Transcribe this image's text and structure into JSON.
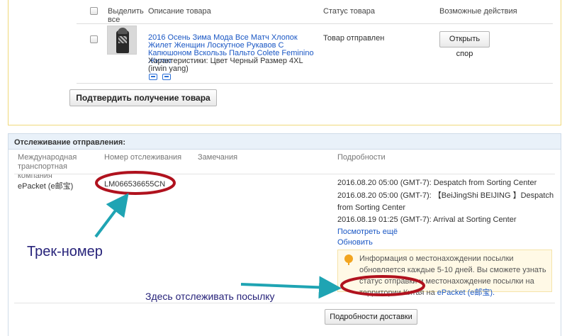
{
  "order": {
    "columns": {
      "select_all": "Выделить все",
      "description": "Описание товара",
      "status": "Статус товара",
      "actions": "Возможные действия"
    },
    "item": {
      "title": "2016 Осень Зима Мода Все Матч Хлопок Жилет Женщин Лоскутное Рукавов С Капюшоном Вскользь Пальто Colete Feminino Жилет",
      "attributes": "Характеристики: Цвет Черный Размер 4XL (irwin yang)",
      "status": "Товар отправлен",
      "dispute_button": "Открыть спор",
      "icons": [
        "shipping-icon",
        "card-icon"
      ]
    },
    "confirm_button": "Подтвердить получение товара"
  },
  "tracking": {
    "title": "Отслеживание отправления:",
    "columns": {
      "carrier": "Международная транспортная компания",
      "number": "Номер отслеживания",
      "notes": "Замечания",
      "details": "Подробности"
    },
    "row": {
      "carrier": "ePacket (e邮宝)",
      "number": "LM066536655CN",
      "events": [
        "2016.08.20 05:00 (GMT-7): Despatch from Sorting Center",
        "2016.08.20 05:00 (GMT-7): 【BeiJingShi BEIJING 】Despatch from Sorting Center",
        "2016.08.19 01:25 (GMT-7): Arrival at Sorting Center"
      ],
      "see_more": "Посмотреть ещё",
      "refresh": "Обновить",
      "info": "Информация о местонахождении посылки обновляется каждые 5-10 дней. Вы сможете узнать статус отправки и местонахождение посылки на территории Китая на",
      "info_link": "ePacket (e邮宝).",
      "delivery_button": "Подробности доставки"
    }
  },
  "annotations": {
    "track_label": "Трек-номер",
    "where_label": "Здесь отслеживать посылку",
    "ellipse_color": "#b0121e",
    "arrow_color": "#1fa4b3",
    "text_color": "#27237a"
  },
  "colors": {
    "link": "#1a57c4",
    "order_border": "#f0d97a",
    "tracking_header_bg": "#e9f1f9",
    "info_bg": "#fff9e6"
  }
}
